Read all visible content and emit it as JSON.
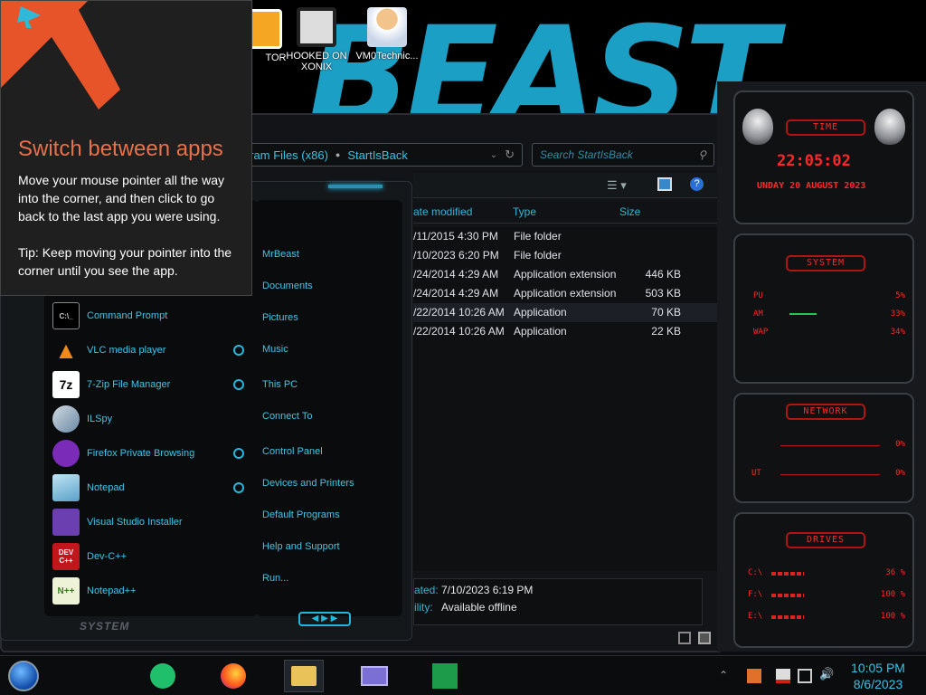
{
  "desktop_icons": [
    {
      "label": "TOR"
    },
    {
      "label": "HOOKED ON XONIX"
    },
    {
      "label": "VM0Technic..."
    }
  ],
  "tip": {
    "title": "Switch between apps",
    "body": "Move your mouse pointer all the way into the corner, and then click to go back to the last app you were using.",
    "tip": "Tip: Keep moving your pointer into the corner until you see the app."
  },
  "explorer": {
    "address_path": "gram Files (x86)",
    "address_current": "StartIsBack",
    "search_placeholder": "Search StartIsBack",
    "columns": [
      "ate modified",
      "Type",
      "Size"
    ],
    "files": [
      {
        "date": "/11/2015 4:30 PM",
        "type": "File folder",
        "size": ""
      },
      {
        "date": "/10/2023 6:20 PM",
        "type": "File folder",
        "size": ""
      },
      {
        "date": "/24/2014 4:29 AM",
        "type": "Application extension",
        "size": "446 KB"
      },
      {
        "date": "/24/2014 4:29 AM",
        "type": "Application extension",
        "size": "503 KB"
      },
      {
        "date": "/22/2014 10:26 AM",
        "type": "Application",
        "size": "70 KB"
      },
      {
        "date": "/22/2014 10:26 AM",
        "type": "Application",
        "size": "22 KB"
      }
    ],
    "details_label1": "ated:",
    "details_value1": "7/10/2023 6:19 PM",
    "details_label2": "ility:",
    "details_value2": "Available offline"
  },
  "start_menu": {
    "programs": [
      {
        "label": "Command Prompt",
        "icon": "cmd-icon",
        "jump": false
      },
      {
        "label": "VLC media player",
        "icon": "vlc-icon",
        "jump": true
      },
      {
        "label": "7-Zip File Manager",
        "icon": "7zip-icon",
        "jump": true
      },
      {
        "label": "ILSpy",
        "icon": "ilspy-icon",
        "jump": false
      },
      {
        "label": "Firefox Private Browsing",
        "icon": "firefox-private-icon",
        "jump": true
      },
      {
        "label": "Notepad",
        "icon": "notepad-icon",
        "jump": true
      },
      {
        "label": "Visual Studio Installer",
        "icon": "vs-installer-icon",
        "jump": false
      },
      {
        "label": "Dev-C++",
        "icon": "devcpp-icon",
        "jump": false
      },
      {
        "label": "Notepad++",
        "icon": "notepadpp-icon",
        "jump": false
      }
    ],
    "places": [
      "MrBeast",
      "Documents",
      "Pictures",
      "Music",
      "This PC",
      "Connect To",
      "Control Panel",
      "Devices and Printers",
      "Default Programs",
      "Help and Support",
      "Run..."
    ],
    "system_label": "SYSTEM"
  },
  "gadgets": {
    "time_title": "TIME",
    "time_value": "22:05:02",
    "date_value": "UNDAY 20 AUGUST 2023",
    "system_title": "SYSTEM",
    "system_rows": [
      {
        "label": "PU",
        "value": "5%"
      },
      {
        "label": "AM",
        "value": "33%"
      },
      {
        "label": "WAP",
        "value": "34%"
      }
    ],
    "network_title": "NETWORK",
    "network_rows": [
      {
        "label": "",
        "value": "0%"
      },
      {
        "label": "UT",
        "value": "0%"
      }
    ],
    "drives_title": "DRIVES",
    "drive_rows": [
      {
        "label": "C:\\",
        "value": "36 %"
      },
      {
        "label": "F:\\",
        "value": "100 %"
      },
      {
        "label": "E:\\",
        "value": "100 %"
      }
    ]
  },
  "taskbar": {
    "time": "10:05 PM",
    "date": "8/6/2023"
  }
}
